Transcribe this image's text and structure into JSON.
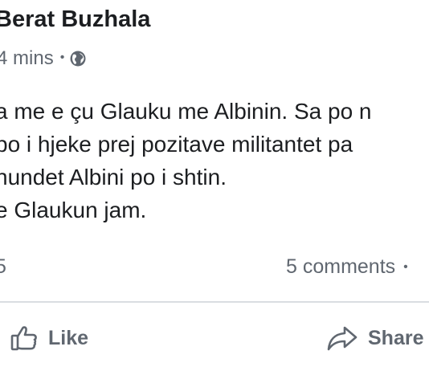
{
  "post": {
    "author": "Berat Buzhala",
    "time": "4 mins",
    "separator": "•",
    "privacy_icon": "globe-icon",
    "lines": [
      "a me e çu Glauku me Albinin. Sa po n",
      "po i hjeke prej pozitave militantet pa",
      "hundet Albini po i shtin.",
      "e Glaukun jam."
    ]
  },
  "counts": {
    "reactions": "5",
    "comments": "5 comments",
    "separator": "•"
  },
  "actions": {
    "like_label": "Like",
    "like_icon": "thumbs-up-icon",
    "share_label": "Share",
    "share_icon": "share-arrow-icon"
  },
  "colors": {
    "text": "#1c1e21",
    "secondary": "#606770",
    "divider": "#dadde1"
  }
}
